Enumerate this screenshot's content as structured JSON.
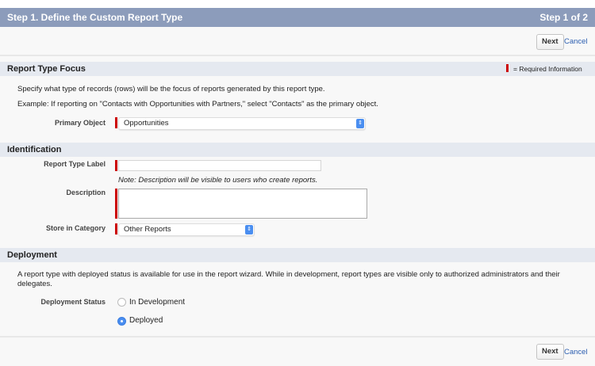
{
  "header": {
    "title": "Step 1. Define the Custom Report Type",
    "step": "Step 1 of 2"
  },
  "buttons": {
    "next": "Next",
    "cancel": "Cancel"
  },
  "required_legend": "= Required Information",
  "focus": {
    "title": "Report Type Focus",
    "line1": "Specify what type of records (rows) will be the focus of reports generated by this report type.",
    "line2": "Example: If reporting on \"Contacts with Opportunities with Partners,\" select \"Contacts\" as the primary object.",
    "primary_object_label": "Primary Object",
    "primary_object_value": "Opportunities"
  },
  "identification": {
    "title": "Identification",
    "label_label": "Report Type Label",
    "label_value": "",
    "note": "Note: Description will be visible to users who create reports.",
    "description_label": "Description",
    "description_value": "",
    "category_label": "Store in Category",
    "category_value": "Other Reports"
  },
  "deployment": {
    "title": "Deployment",
    "text": "A report type with deployed status is available for use in the report wizard. While in development, report types are visible only to authorized administrators and their delegates.",
    "status_label": "Deployment Status",
    "options": [
      "In Development",
      "Deployed"
    ],
    "selected": "Deployed"
  },
  "colors": {
    "header": "#8c9cbb",
    "required": "#cc0000",
    "accent": "#4a8ef0"
  }
}
